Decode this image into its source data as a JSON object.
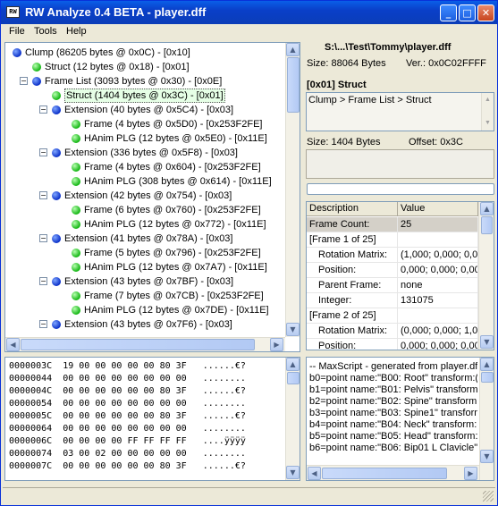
{
  "window": {
    "title": "RW Analyze 0.4 BETA - player.dff",
    "icon_text": "RW"
  },
  "menu": [
    "File",
    "Tools",
    "Help"
  ],
  "tree": [
    {
      "indent": 0,
      "type": "blue",
      "expander": "",
      "label": "Clump  (86205 bytes @ 0x0C) - [0x10]"
    },
    {
      "indent": 1,
      "type": "green",
      "expander": "",
      "label": "Struct  (12 bytes @ 0x18) - [0x01]"
    },
    {
      "indent": 1,
      "type": "blue",
      "expander": "−",
      "label": "Frame List  (3093 bytes @ 0x30) - [0x0E]"
    },
    {
      "indent": 2,
      "type": "green",
      "expander": "",
      "label": "Struct  (1404 bytes @ 0x3C) - [0x01]",
      "selected": true
    },
    {
      "indent": 2,
      "type": "blue",
      "expander": "−",
      "label": "Extension  (40 bytes @ 0x5C4) - [0x03]"
    },
    {
      "indent": 3,
      "type": "green",
      "expander": "",
      "label": "Frame  (4 bytes @ 0x5D0) - [0x253F2FE]"
    },
    {
      "indent": 3,
      "type": "green",
      "expander": "",
      "label": "HAnim PLG  (12 bytes @ 0x5E0) - [0x11E]"
    },
    {
      "indent": 2,
      "type": "blue",
      "expander": "−",
      "label": "Extension  (336 bytes @ 0x5F8) - [0x03]"
    },
    {
      "indent": 3,
      "type": "green",
      "expander": "",
      "label": "Frame  (4 bytes @ 0x604) - [0x253F2FE]"
    },
    {
      "indent": 3,
      "type": "green",
      "expander": "",
      "label": "HAnim PLG  (308 bytes @ 0x614) - [0x11E]"
    },
    {
      "indent": 2,
      "type": "blue",
      "expander": "−",
      "label": "Extension  (42 bytes @ 0x754) - [0x03]"
    },
    {
      "indent": 3,
      "type": "green",
      "expander": "",
      "label": "Frame  (6 bytes @ 0x760) - [0x253F2FE]"
    },
    {
      "indent": 3,
      "type": "green",
      "expander": "",
      "label": "HAnim PLG  (12 bytes @ 0x772) - [0x11E]"
    },
    {
      "indent": 2,
      "type": "blue",
      "expander": "−",
      "label": "Extension  (41 bytes @ 0x78A) - [0x03]"
    },
    {
      "indent": 3,
      "type": "green",
      "expander": "",
      "label": "Frame  (5 bytes @ 0x796) - [0x253F2FE]"
    },
    {
      "indent": 3,
      "type": "green",
      "expander": "",
      "label": "HAnim PLG  (12 bytes @ 0x7A7) - [0x11E]"
    },
    {
      "indent": 2,
      "type": "blue",
      "expander": "−",
      "label": "Extension  (43 bytes @ 0x7BF) - [0x03]"
    },
    {
      "indent": 3,
      "type": "green",
      "expander": "",
      "label": "Frame  (7 bytes @ 0x7CB) - [0x253F2FE]"
    },
    {
      "indent": 3,
      "type": "green",
      "expander": "",
      "label": "HAnim PLG  (12 bytes @ 0x7DE) - [0x11E]"
    },
    {
      "indent": 2,
      "type": "blue",
      "expander": "−",
      "label": "Extension  (43 bytes @ 0x7F6) - [0x03]"
    }
  ],
  "hex_lines": [
    "0000003C  19 00 00 00 00 00 80 3F   ......€?",
    "00000044  00 00 00 00 00 00 00 00   ........",
    "0000004C  00 00 00 00 00 00 80 3F   ......€?",
    "00000054  00 00 00 00 00 00 00 00   ........",
    "0000005C  00 00 00 00 00 00 80 3F   ......€?",
    "00000064  00 00 00 00 00 00 00 00   ........",
    "0000006C  00 00 00 00 FF FF FF FF   ....ÿÿÿÿ",
    "00000074  03 00 02 00 00 00 00 00   ........",
    "0000007C  00 00 00 00 00 00 80 3F   ......€?"
  ],
  "file_info": {
    "path": "S:\\...\\Test\\Tommy\\player.dff",
    "size": "Size: 88064 Bytes",
    "version": "Ver.: 0x0C02FFFF"
  },
  "section": {
    "title": "[0x01] Struct",
    "breadcrumb": "Clump > Frame List > Struct",
    "size": "Size: 1404 Bytes",
    "offset": "Offset: 0x3C"
  },
  "progress": 0,
  "props": {
    "headers": [
      "Description",
      "Value"
    ],
    "rows": [
      {
        "desc": "Frame Count:",
        "value": "25",
        "kind": "highlight"
      },
      {
        "desc": "[Frame 1 of 25]",
        "value": "",
        "kind": "group"
      },
      {
        "desc": "Rotation Matrix:",
        "value": "(1,000; 0,000; 0,0",
        "kind": "item"
      },
      {
        "desc": "Position:",
        "value": "0,000; 0,000; 0,00",
        "kind": "item"
      },
      {
        "desc": "Parent Frame:",
        "value": "none",
        "kind": "item"
      },
      {
        "desc": "Integer:",
        "value": "131075",
        "kind": "item"
      },
      {
        "desc": "[Frame 2 of 25]",
        "value": "",
        "kind": "group"
      },
      {
        "desc": "Rotation Matrix:",
        "value": "(0,000; 0,000; 1,0",
        "kind": "item"
      },
      {
        "desc": "Position:",
        "value": "0,000; 0,000; 0,00",
        "kind": "item"
      }
    ]
  },
  "maxscript": [
    "-- MaxScript - generated from player.dff",
    "b0=point name:\"B00: Root\" transform:((",
    "b1=point name:\"B01: Pelvis\" transform:",
    "b2=point name:\"B02: Spine\" transform:(",
    "b3=point name:\"B03: Spine1\" transform",
    "b4=point name:\"B04: Neck\" transform:(",
    "b5=point name:\"B05: Head\" transform:(",
    "b6=point name:\"B06: Bip01 L Clavicle\""
  ]
}
